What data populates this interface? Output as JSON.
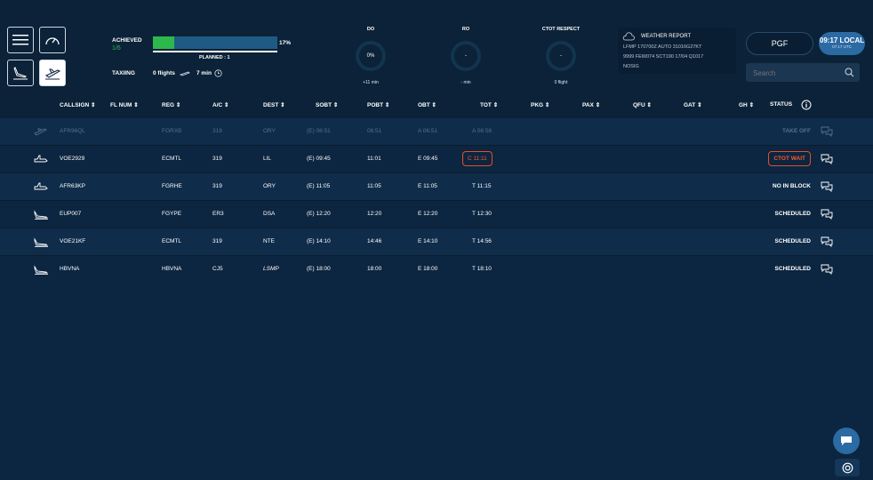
{
  "top": {
    "achieved_label": "ACHIEVED",
    "achieved_value": "1/6",
    "progress_pct_label": "17%",
    "progress_fraction": 0.17,
    "planned_label": "PLANNED : 1",
    "taxiing_label": "TAXIING",
    "taxiing_flights": "0 flights",
    "taxiing_time": "7 min"
  },
  "gauges": [
    {
      "title": "DO",
      "value": "0%",
      "sub": "+11 min"
    },
    {
      "title": "RO",
      "value": "-",
      "sub": "- min"
    },
    {
      "title": "CTOT RESPECT",
      "value": "-",
      "sub": "0 flight"
    }
  ],
  "weather": {
    "title": "WEATHER REPORT",
    "line1": "LFMP 170700Z AUTO 31016G27KT",
    "line2": "9999 FEW074 SCT190 17/04 Q1017",
    "line3": "NOSIG"
  },
  "airport": "PGF",
  "clock": {
    "local": "09:17 LOCAL",
    "utc": "07:17 UTC"
  },
  "search": {
    "placeholder": "Search"
  },
  "columns": [
    "CALLSIGN",
    "FL NUM",
    "REG",
    "A/C",
    "DEST",
    "SOBT",
    "POBT",
    "OBT",
    "TOT",
    "PKG",
    "PAX",
    "QFU",
    "GAT",
    "GH",
    "STATUS"
  ],
  "flights": [
    {
      "icon": "takeoff",
      "callsign": "AFR96QL",
      "reg": "FGRXB",
      "ac": "319",
      "dest": "ORY",
      "sobt": "(E) 06:51",
      "pobt": "06:51",
      "obt": "A 06:51",
      "tot": "A 06:58",
      "status": "TAKE OFF",
      "dim": true,
      "tot_boxed": false,
      "status_boxed": false
    },
    {
      "icon": "plane",
      "callsign": "VOE2929",
      "reg": "ECMTL",
      "ac": "319",
      "dest": "LIL",
      "sobt": "(E) 09:45",
      "pobt": "11:01",
      "obt": "E 09:45",
      "tot": "C 11:11",
      "status": "CTOT WAIT",
      "dim": false,
      "tot_boxed": true,
      "status_boxed": true
    },
    {
      "icon": "plane",
      "callsign": "AFR63KP",
      "reg": "FGRHE",
      "ac": "319",
      "dest": "ORY",
      "sobt": "(E) 11:05",
      "pobt": "11:05",
      "obt": "E 11:05",
      "tot": "T 11:15",
      "status": "NO IN BLOCK",
      "dim": false,
      "tot_boxed": false,
      "status_boxed": false
    },
    {
      "icon": "landing",
      "callsign": "EUP007",
      "reg": "FGYPE",
      "ac": "ER3",
      "dest": "DSA",
      "sobt": "(E) 12:20",
      "pobt": "12:20",
      "obt": "E 12:20",
      "tot": "T 12:30",
      "status": "SCHEDULED",
      "dim": false,
      "tot_boxed": false,
      "status_boxed": false
    },
    {
      "icon": "landing",
      "callsign": "VOE21KF",
      "reg": "ECMTL",
      "ac": "319",
      "dest": "NTE",
      "sobt": "(E) 14:10",
      "pobt": "14:46",
      "obt": "E 14:10",
      "tot": "T 14:56",
      "status": "SCHEDULED",
      "dim": false,
      "tot_boxed": false,
      "status_boxed": false
    },
    {
      "icon": "landing",
      "callsign": "HBVNA",
      "reg": "HBVNA",
      "ac": "CJ5",
      "dest": "LSMP",
      "sobt": "(E) 18:00",
      "pobt": "18:00",
      "obt": "E 18:00",
      "tot": "T 18:10",
      "status": "SCHEDULED",
      "dim": false,
      "tot_boxed": false,
      "status_boxed": false,
      "dest_italic": true
    }
  ]
}
